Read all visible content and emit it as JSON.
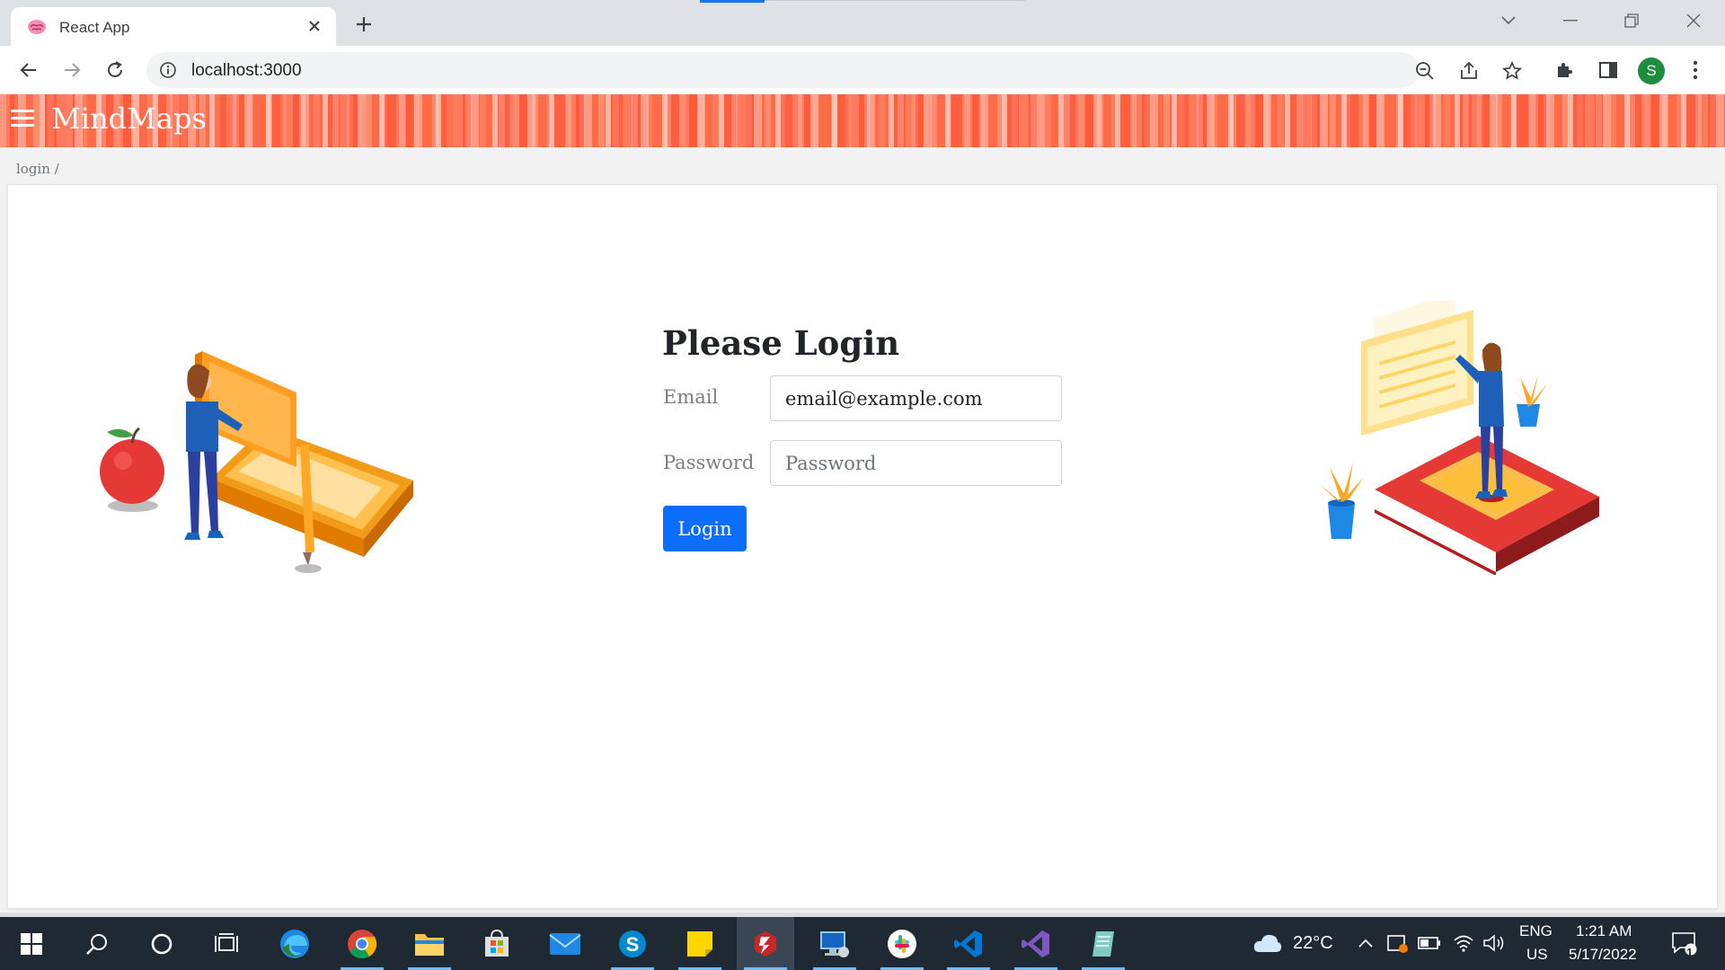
{
  "browser": {
    "tab_title": "React App",
    "url": "localhost:3000",
    "profile_initial": "S"
  },
  "app": {
    "brand": "MindMaps",
    "breadcrumb": "login /"
  },
  "login": {
    "title": "Please Login",
    "email_label": "Email",
    "email_value": "email@example.com",
    "password_label": "Password",
    "password_placeholder": "Password",
    "button_label": "Login"
  },
  "taskbar": {
    "weather": "22°C",
    "language": "ENG",
    "region": "US",
    "time": "1:21 AM",
    "date": "5/17/2022",
    "notification_count": "1"
  },
  "colors": {
    "brand_header": "#ff6a47",
    "login_button": "#0d6efd",
    "taskbar": "#1f2933"
  }
}
